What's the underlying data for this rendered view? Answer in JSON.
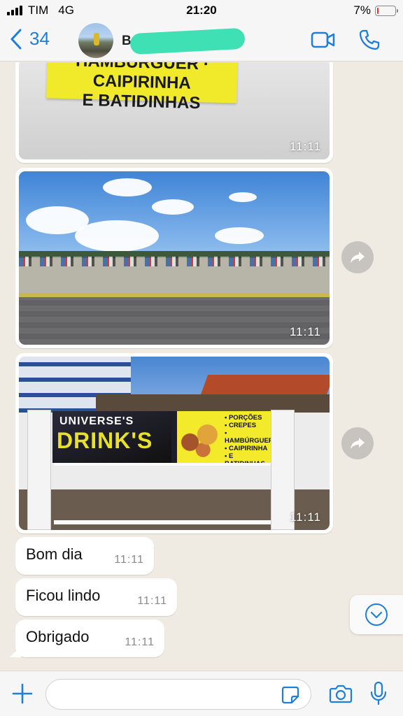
{
  "status_bar": {
    "carrier": "TIM",
    "network": "4G",
    "time": "21:20",
    "battery_percent": "7%",
    "battery_level": 0.07,
    "battery_color": "#e0342f"
  },
  "header": {
    "back_count": "34",
    "contact_name_visible": "B",
    "accent_color": "#1f7ed8",
    "icons": [
      "back-chevron-icon",
      "video-camera-icon",
      "phone-icon"
    ]
  },
  "messages": {
    "images": [
      {
        "banner_text_line1": "HAMBÚRGUER · CAIPIRINHA",
        "banner_text_line2": "E BATIDINHAS",
        "time": "11:11"
      },
      {
        "time": "11:11"
      },
      {
        "banner_title": "UNIVERSE'S",
        "banner_brand": "DRINK'S",
        "banner_items": [
          "• PORÇÕES",
          "• CREPES",
          "• HAMBÚRGUER",
          "• CAIPIRINHA",
          "• E BATIDINHAS"
        ],
        "time": "11:11"
      }
    ],
    "texts": [
      {
        "text": "Bom dia",
        "time": "11:11"
      },
      {
        "text": "Ficou lindo",
        "time": "11:11"
      },
      {
        "text": "Obrigado",
        "time": "11:11"
      }
    ]
  },
  "composer": {
    "placeholder": "",
    "icons": [
      "plus-icon",
      "sticker-icon",
      "camera-icon",
      "microphone-icon"
    ]
  }
}
